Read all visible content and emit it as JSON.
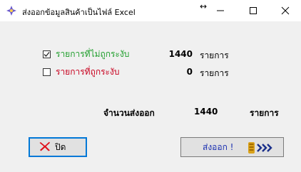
{
  "window": {
    "title": "ส่งออกข้อมูลสินค้าเป็นไฟล์ Excel",
    "resize_indicator": "↔",
    "controls": {
      "minimize": "—",
      "maximize": "☐",
      "close": "✕"
    }
  },
  "options": [
    {
      "label": "รายการที่ไม่ถูกระงับ",
      "checked": true,
      "count": "1440",
      "unit": "รายการ",
      "color": "#1f9e2c"
    },
    {
      "label": "รายการที่ถูกระงับ",
      "checked": false,
      "count": "0",
      "unit": "รายการ",
      "color": "#c8001e"
    }
  ],
  "summary": {
    "label": "จำนวนส่งออก",
    "value": "1440",
    "unit": "รายการ"
  },
  "buttons": {
    "close_label": "ปิด",
    "close_icon": "red-x-icon",
    "export_label": "ส่งออก !",
    "export_icon": "export-arrows-icon"
  }
}
